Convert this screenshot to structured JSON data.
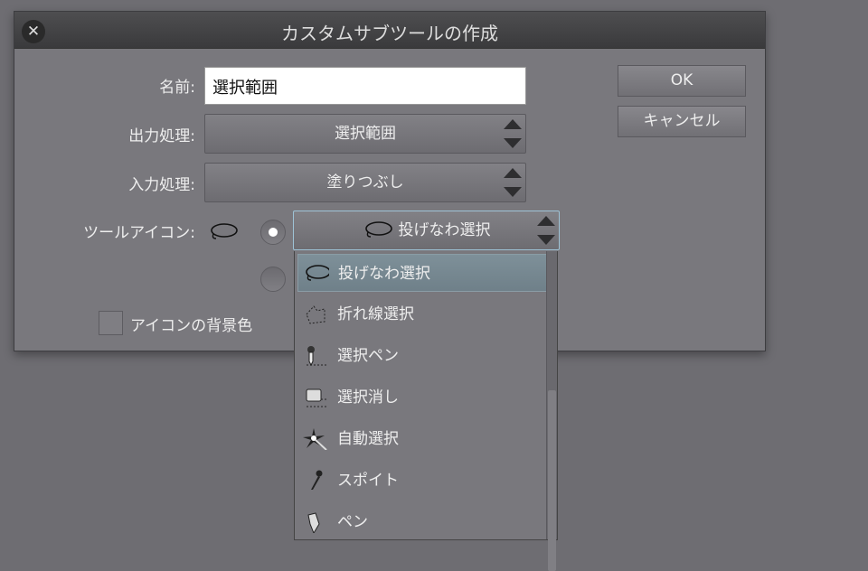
{
  "dialog": {
    "title": "カスタムサブツールの作成",
    "close_icon": "close-icon"
  },
  "form": {
    "name_label": "名前:",
    "name_value": "選択範囲",
    "output_label": "出力処理:",
    "output_value": "選択範囲",
    "input_label": "入力処理:",
    "input_value": "塗りつぶし",
    "icon_label": "ツールアイコン:",
    "icon_value": "投げなわ選択",
    "bg_label": "アイコンの背景色"
  },
  "buttons": {
    "ok": "OK",
    "cancel": "キャンセル"
  },
  "dropdown": {
    "items": [
      {
        "label": "投げなわ選択",
        "icon": "lasso-icon",
        "selected": true
      },
      {
        "label": "折れ線選択",
        "icon": "polyline-select-icon"
      },
      {
        "label": "選択ペン",
        "icon": "select-pen-icon"
      },
      {
        "label": "選択消し",
        "icon": "select-eraser-icon"
      },
      {
        "label": "自動選択",
        "icon": "magic-wand-icon"
      },
      {
        "label": "スポイト",
        "icon": "eyedropper-icon"
      },
      {
        "label": "ペン",
        "icon": "pen-icon"
      }
    ]
  }
}
